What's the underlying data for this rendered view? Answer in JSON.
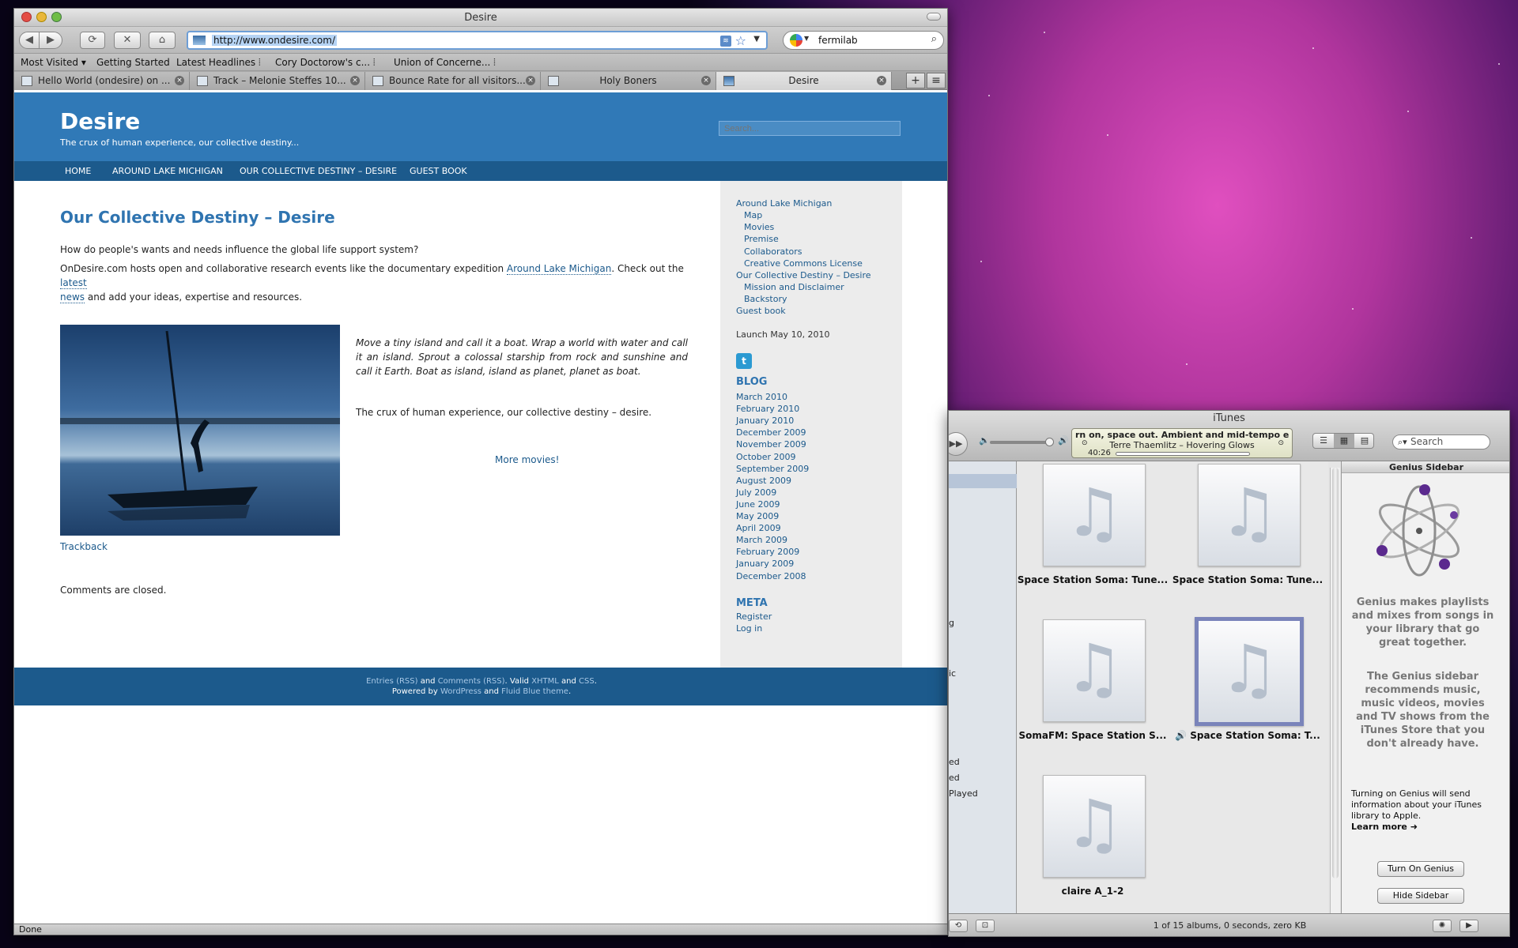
{
  "browser": {
    "title": "Desire",
    "url": "http://www.ondesire.com/",
    "search_query": "fermilab",
    "bookmarks": [
      "Most Visited",
      "Getting Started",
      "Latest Headlines",
      "Cory Doctorow's c...",
      "Union of Concerne..."
    ],
    "tabs": [
      {
        "label": "Hello World (ondesire) on ..."
      },
      {
        "label": "Track – Melonie Steffes 10..."
      },
      {
        "label": "Bounce Rate for all visitors..."
      },
      {
        "label": "Holy Boners"
      },
      {
        "label": "Desire"
      }
    ],
    "status": "Done"
  },
  "site": {
    "title": "Desire",
    "description": "The crux of human experience, our collective destiny...",
    "search_placeholder": "Search...",
    "nav": [
      "HOME",
      "AROUND LAKE MICHIGAN",
      "OUR COLLECTIVE DESTINY – DESIRE",
      "GUEST BOOK"
    ],
    "post": {
      "title": "Our Collective Destiny – Desire",
      "p1": "How do people's wants and needs influence the global life support system?",
      "p2_a": "OnDesire.com hosts open and collaborative research events like the documentary expedition ",
      "p2_link1": "Around Lake Michigan",
      "p2_b": ". Check out the ",
      "p2_link2a": "latest",
      "p2_link2b": "news",
      "p2_c": " and add your ideas, expertise and resources.",
      "quote": "Move a tiny island and call it a boat. Wrap a world with water and call it an island. Sprout a colossal starship from rock and sunshine and call it Earth. Boat as island, island as planet, planet as boat.",
      "crux": "The crux of human experience, our collective destiny – desire.",
      "more": "More movies!",
      "trackback": "Trackback",
      "comments": "Comments are closed."
    },
    "sidebar": {
      "pages": [
        "Around Lake Michigan",
        "Map",
        "Movies",
        "Premise",
        "Collaborators",
        "Creative Commons License",
        "Our Collective Destiny – Desire",
        "Mission and Disclaimer",
        "Backstory",
        "Guest book"
      ],
      "launch": "Launch May 10, 2010",
      "blog_heading": "BLOG",
      "archives": [
        "March 2010",
        "February 2010",
        "January 2010",
        "December 2009",
        "November 2009",
        "October 2009",
        "September 2009",
        "August 2009",
        "July 2009",
        "June 2009",
        "May 2009",
        "April 2009",
        "March 2009",
        "February 2009",
        "January 2009",
        "December 2008"
      ],
      "meta_heading": "META",
      "meta": [
        "Register",
        "Log in"
      ]
    },
    "footer": {
      "entries": "Entries (RSS)",
      "and1": " and ",
      "comments": "Comments (RSS)",
      "valid": ". Valid ",
      "xhtml": "XHTML",
      "and2": " and ",
      "css": "CSS",
      "dot": ".",
      "powered": "Powered by ",
      "wordpress": "WordPress",
      "and3": " and ",
      "theme": "Fluid Blue theme",
      "dot2": "."
    }
  },
  "itunes": {
    "title": "iTunes",
    "lcd_line1": "rn on, space out. Ambient and mid-tempo electr",
    "lcd_line2": "Terre Thaemlitz – Hovering Glows",
    "lcd_time": "40:26",
    "search_placeholder": "Search",
    "source_fragments": [
      "g",
      "ic",
      "ed",
      "ed",
      "Played"
    ],
    "albums": [
      {
        "caption": "Space Station Soma: Tune..."
      },
      {
        "caption": "Space Station Soma: Tune..."
      },
      {
        "caption": "SomaFM: Space Station S..."
      },
      {
        "caption": "Space Station Soma: T..."
      },
      {
        "caption": "claire A_1-2"
      }
    ],
    "genius": {
      "title": "Genius Sidebar",
      "bold1": "Genius makes playlists and mixes from songs in your library that go great together.",
      "bold2": "The Genius sidebar recommends music, music videos, movies and TV shows from the iTunes Store that you don't already have.",
      "small": "Turning on Genius will send information about your iTunes library to Apple.",
      "learn_more": "Learn more",
      "turn_on": "Turn On Genius",
      "hide": "Hide Sidebar"
    },
    "status": "1 of 15 albums, 0 seconds, zero KB"
  },
  "colors": {
    "site_blue": "#3079b7",
    "nav_blue": "#1c5a8c",
    "link": "#1c5a8c"
  }
}
